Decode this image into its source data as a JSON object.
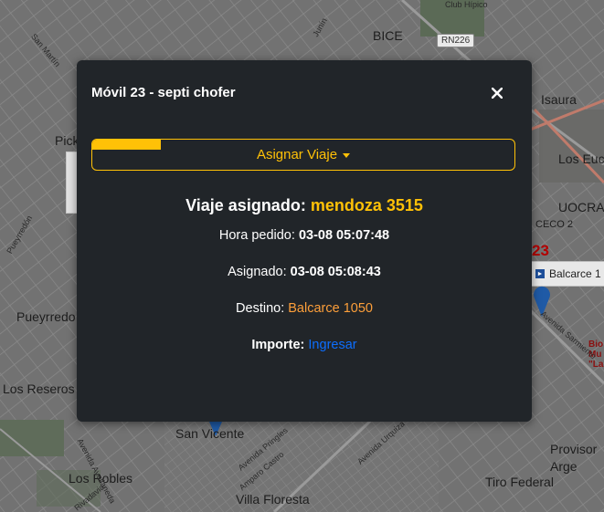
{
  "map": {
    "labels": {
      "club_hipico": "Club Hípico",
      "bice": "BICE",
      "route": "RN226",
      "isaura": "Isaura",
      "los_euc": "Los Euc",
      "pick": "Pick",
      "uocra": "UOCRA",
      "cecco": "CECO 2",
      "num23": "23",
      "pueyrredon": "Pueyrredo",
      "los_reseros": "Los Reseros",
      "san_vicente": "San Vicente",
      "los_robles": "Los Robles",
      "villa_floresta": "Villa Floresta",
      "tiro_federal": "Tiro Federal",
      "provisor": "Provisor",
      "arge": "Arge",
      "san_martin": "San Martín",
      "av_sarmiento": "Avenida Sarmiento",
      "av_urquiza": "Avenida Urquiza",
      "av_pringles": "Avenida Pringles",
      "av_avellaneda": "Avenida Avellaneda",
      "amparo_castro": "Amparo Castro",
      "rivadavia": "Rivadavia",
      "junin": "Junín",
      "pueyrredon_st": "Pueyrredón",
      "museo": "Bio\nMu\n\"La M"
    },
    "info_card": {
      "text": "Balcarce 1",
      "icon": "forward-icon"
    }
  },
  "modal": {
    "title": "Móvil 23 - septi chofer",
    "close_icon": "close-icon",
    "assign_button": "Asignar Viaje",
    "progress_percent": 16,
    "trip_label": "Viaje asignado:",
    "trip_value": "mendoza 3515",
    "hora_pedido_label": "Hora pedido:",
    "hora_pedido_value": "03-08 05:07:48",
    "asignado_label": "Asignado:",
    "asignado_value": "03-08 05:08:43",
    "destino_label": "Destino:",
    "destino_value": "Balcarce 1050",
    "importe_label": "Importe:",
    "importe_link": "Ingresar"
  },
  "colors": {
    "modal_bg": "#212529",
    "accent": "#ffc107",
    "destino": "#fd9f3a",
    "link": "#0d6efd"
  }
}
